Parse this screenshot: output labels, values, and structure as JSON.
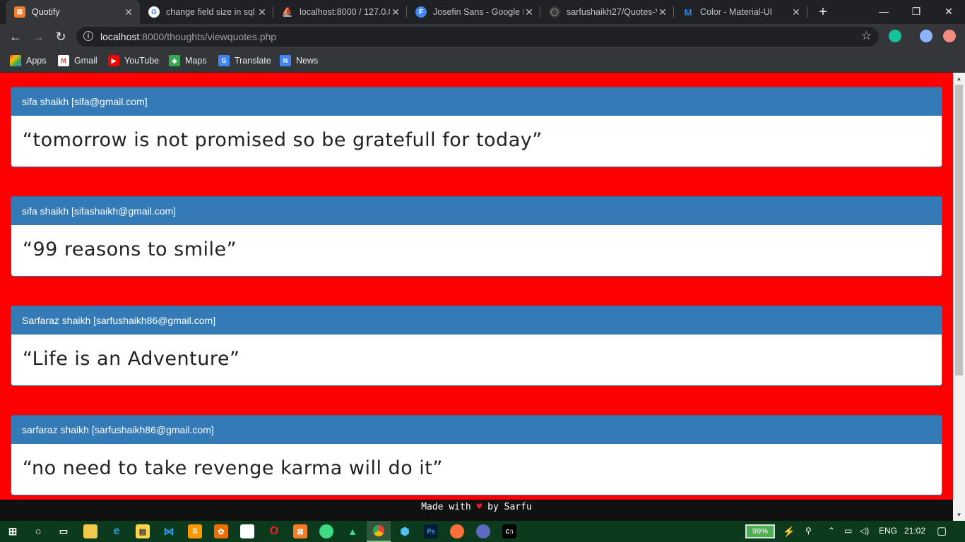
{
  "browser": {
    "tabs": [
      {
        "title": "Quotify",
        "icon": "xampp-icon",
        "icon_color": "#fb7a24",
        "icon_glyph": "⊠",
        "active": true
      },
      {
        "title": "change field size in sql",
        "icon": "google-icon",
        "icon_color": "#ffffff",
        "icon_glyph": "G"
      },
      {
        "title": "localhost:8000 / 127.0.0",
        "icon": "phpmyadmin-icon",
        "icon_color": "#f29111",
        "icon_glyph": "⛵"
      },
      {
        "title": "Josefin Sans - Google F",
        "icon": "google-fonts-icon",
        "icon_color": "#4285f4",
        "icon_glyph": "F"
      },
      {
        "title": "sarfushaikh27/Quotes-V",
        "icon": "github-icon",
        "icon_color": "#202124",
        "icon_glyph": "◯"
      },
      {
        "title": "Color - Material-UI",
        "icon": "material-ui-icon",
        "icon_color": "#1e88e5",
        "icon_glyph": "M"
      }
    ],
    "new_tab_glyph": "+",
    "window_controls": {
      "minimize": "—",
      "restore": "❐",
      "close": "✕"
    },
    "address": {
      "host": "localhost",
      "path": ":8000/thoughts/viewquotes.php"
    },
    "bookmarks": [
      {
        "label": "Apps",
        "icon": "apps-grid-icon",
        "color": "#ea4335"
      },
      {
        "label": "Gmail",
        "icon": "gmail-icon",
        "color": "#ea4335"
      },
      {
        "label": "YouTube",
        "icon": "youtube-icon",
        "color": "#ff0000"
      },
      {
        "label": "Maps",
        "icon": "maps-icon",
        "color": "#34a853"
      },
      {
        "label": "Translate",
        "icon": "translate-icon",
        "color": "#4285f4"
      },
      {
        "label": "News",
        "icon": "news-icon",
        "color": "#4285f4"
      }
    ]
  },
  "page": {
    "background": "#ff0000",
    "header_color": "#337ab7",
    "quotes": [
      {
        "author": "sifa shaikh [sifa@gmail.com]",
        "text": "“tomorrow is not promised so be gratefull for today”"
      },
      {
        "author": "sifa shaikh [sifashaikh@gmail.com]",
        "text": "“99 reasons to smile”"
      },
      {
        "author": "Sarfaraz shaikh [sarfushaikh86@gmail.com]",
        "text": "“Life is an Adventure”"
      },
      {
        "author": "sarfaraz shaikh [sarfushaikh86@gmail.com]",
        "text": "“no need to take revenge karma will do it”"
      }
    ],
    "footer": {
      "before": "Made with",
      "heart": "♥",
      "after": "by Sarfu"
    }
  },
  "taskbar": {
    "battery": "99%",
    "language": "ENG",
    "time": "21:02"
  }
}
